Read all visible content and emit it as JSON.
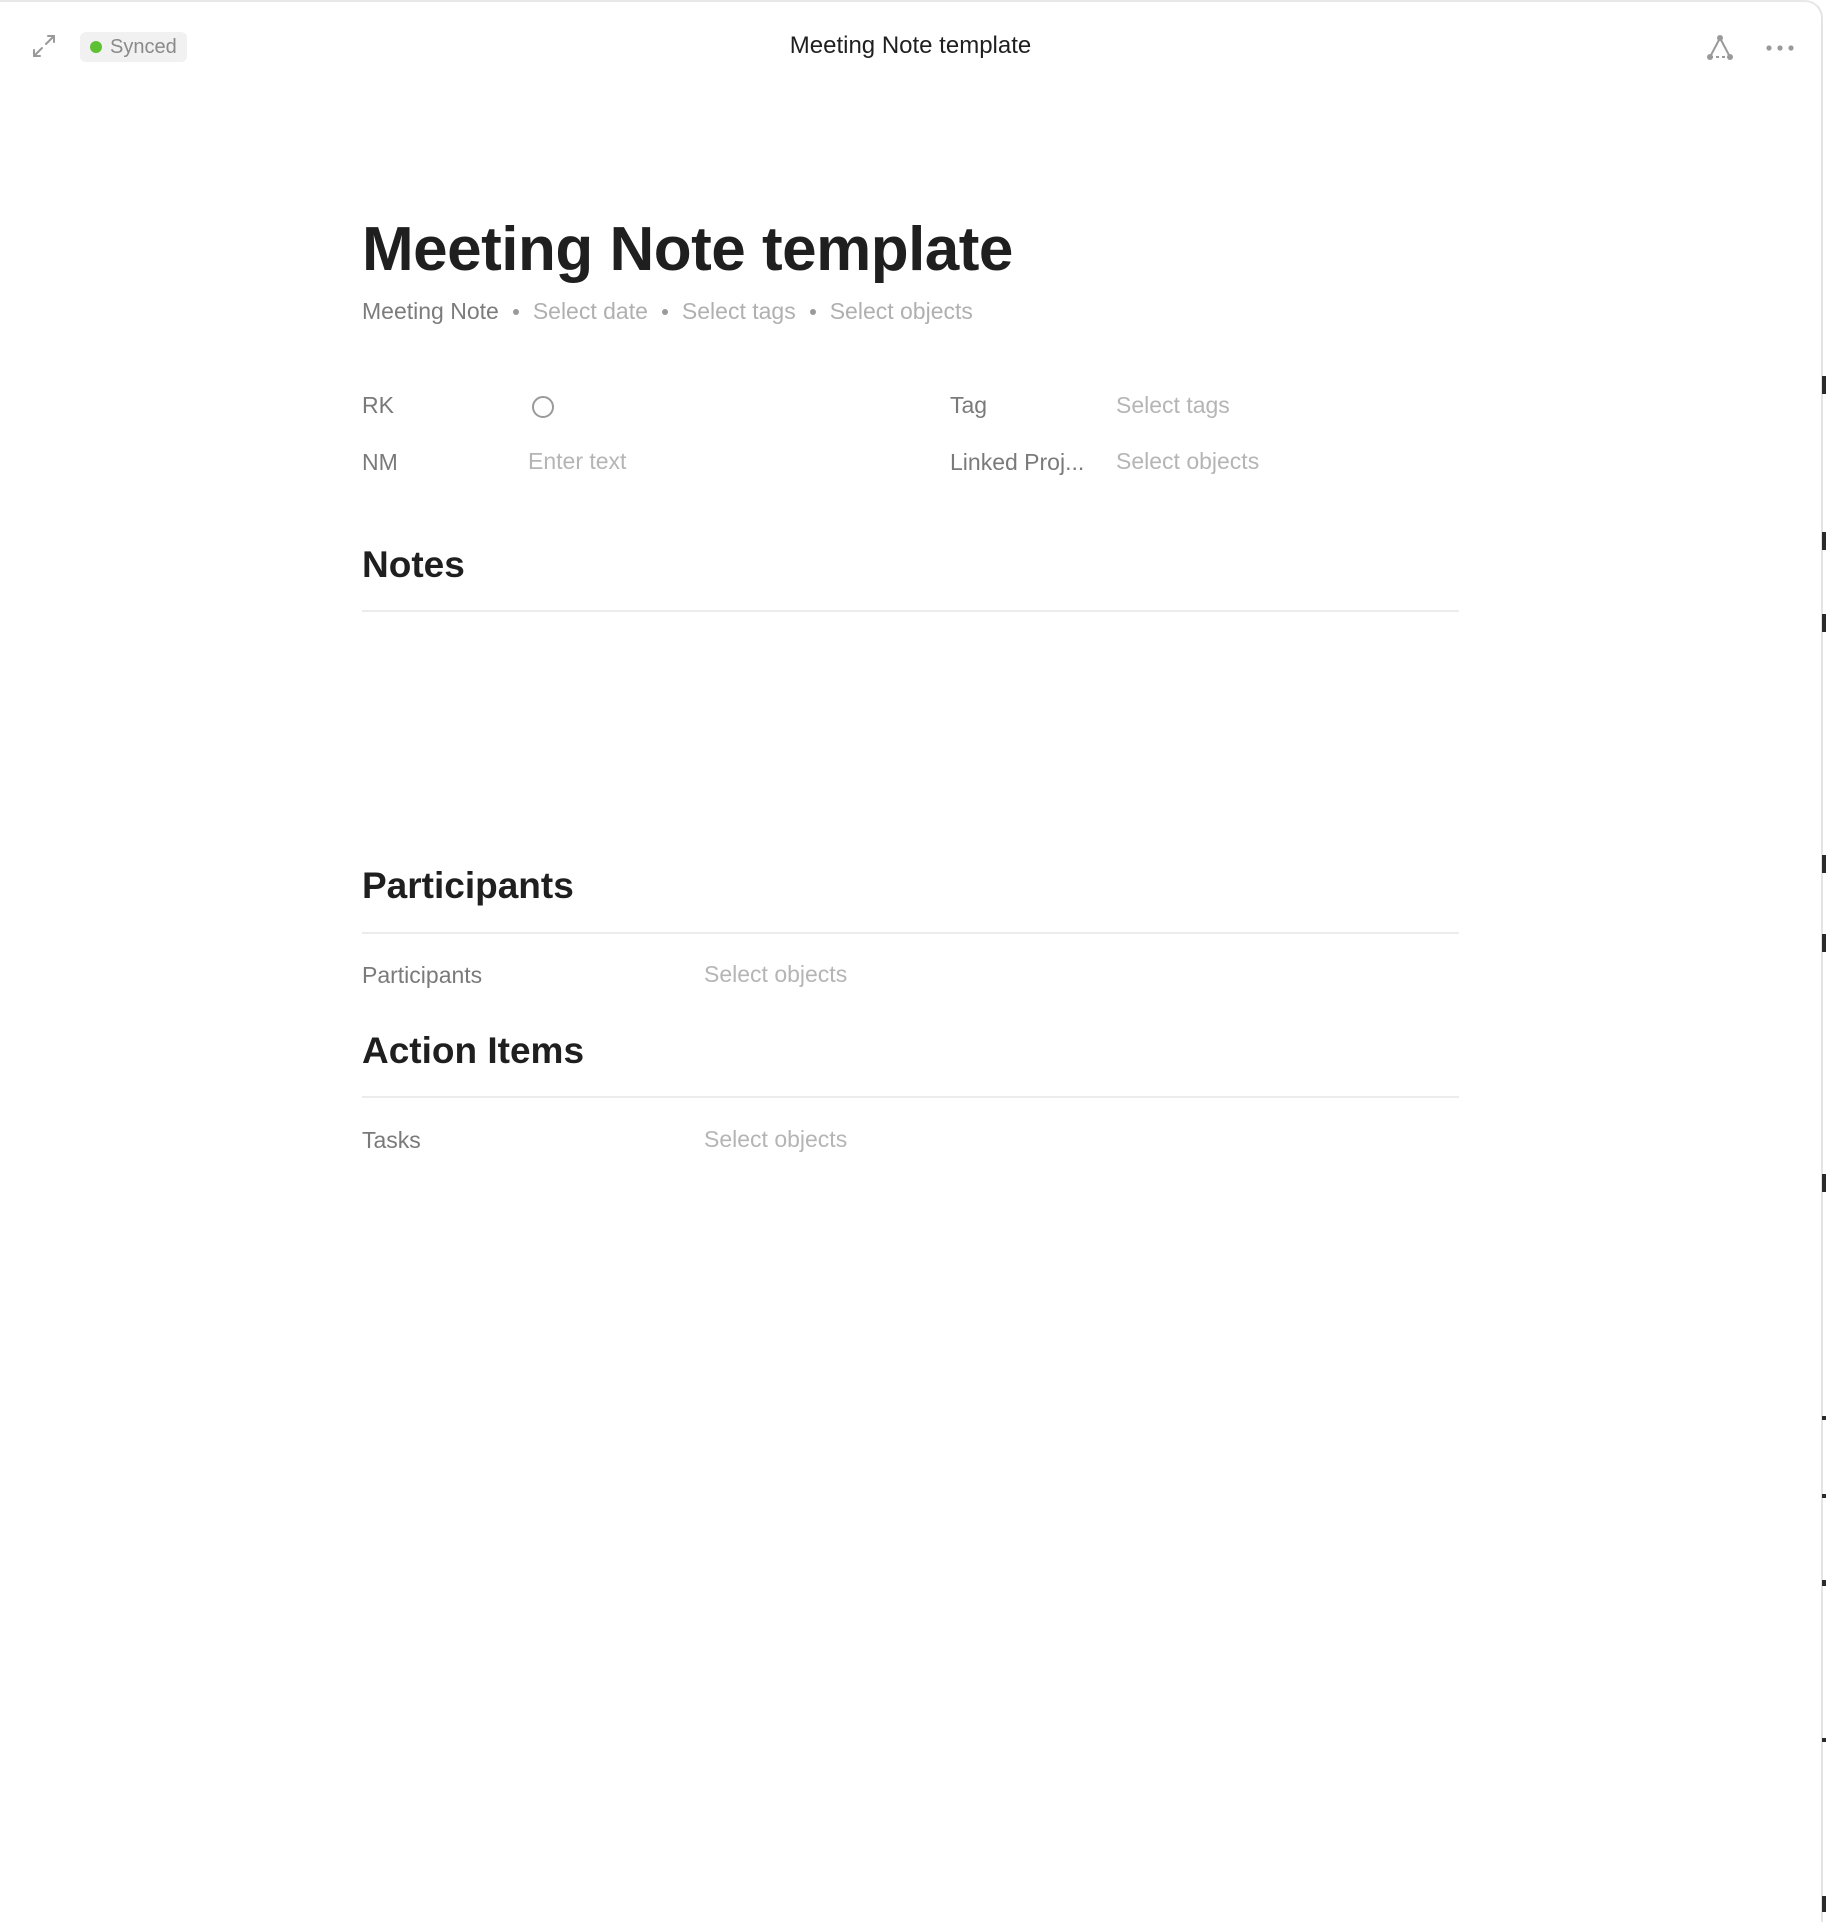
{
  "header": {
    "expand_icon": "expand-arrows-icon",
    "sync_status": "Synced",
    "sync_color": "#5ec133",
    "window_title": "Meeting Note template",
    "graph_icon": "graph-icon",
    "more_icon": "more-horizontal-icon"
  },
  "page": {
    "title": "Meeting Note template",
    "meta": {
      "type": "Meeting Note",
      "date": "Select date",
      "tags": "Select tags",
      "objects": "Select objects"
    }
  },
  "properties": {
    "rk": {
      "label": "RK"
    },
    "nm": {
      "label": "NM",
      "placeholder": "Enter text"
    },
    "tag": {
      "label": "Tag",
      "placeholder": "Select tags"
    },
    "linked_projects": {
      "label": "Linked Proj...",
      "placeholder": "Select objects"
    }
  },
  "sections": {
    "notes": {
      "heading": "Notes"
    },
    "participants": {
      "heading": "Participants",
      "field_label": "Participants",
      "field_placeholder": "Select objects"
    },
    "action_items": {
      "heading": "Action Items",
      "field_label": "Tasks",
      "field_placeholder": "Select objects"
    }
  }
}
